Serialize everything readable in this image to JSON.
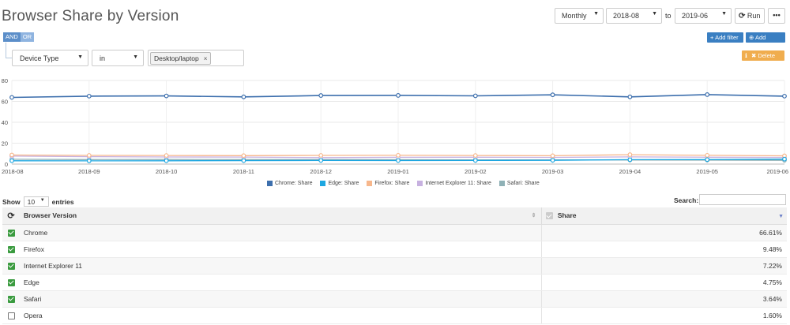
{
  "header": {
    "title": "Browser Share by Version",
    "interval": "Monthly",
    "date_from": "2018-08",
    "to_label": "to",
    "date_to": "2019-06",
    "run_label": "Run",
    "more_label": "•••"
  },
  "filters": {
    "and_label": "AND",
    "or_label": "OR",
    "add_filter_label": "Add filter",
    "add_group_label": "Add group",
    "delete_label": "Delete",
    "field": "Device Type",
    "operator": "in",
    "value_tag": "Desktop/laptop"
  },
  "chart_data": {
    "type": "line",
    "x": [
      "2018-08",
      "2018-09",
      "2018-10",
      "2018-11",
      "2018-12",
      "2019-01",
      "2019-02",
      "2019-03",
      "2019-04",
      "2019-05",
      "2019-06"
    ],
    "ylim": [
      0,
      80
    ],
    "yticks": [
      0,
      20,
      40,
      60,
      80
    ],
    "grid": true,
    "legend_position": "bottom",
    "series": [
      {
        "name": "Chrome: Share",
        "color": "#3d6fad",
        "values": [
          63.8,
          65.0,
          65.2,
          64.3,
          65.6,
          65.7,
          65.3,
          66.3,
          64.3,
          66.5,
          65.0
        ]
      },
      {
        "name": "Edge: Share",
        "color": "#1ea7e1",
        "values": [
          3.2,
          3.1,
          3.2,
          3.3,
          3.5,
          3.4,
          3.5,
          3.6,
          4.2,
          4.3,
          4.75
        ]
      },
      {
        "name": "Firefox: Share",
        "color": "#f7b78c",
        "values": [
          8.7,
          8.3,
          8.2,
          8.1,
          8.3,
          8.4,
          8.2,
          8.0,
          9.0,
          8.4,
          7.9
        ]
      },
      {
        "name": "Internet Explorer 11: Share",
        "color": "#c7b1e0",
        "values": [
          7.6,
          7.1,
          6.8,
          6.7,
          6.2,
          6.5,
          6.6,
          6.4,
          6.9,
          6.6,
          6.4
        ]
      },
      {
        "name": "Safari: Share",
        "color": "#8fb1b6",
        "values": [
          4.6,
          4.3,
          4.4,
          4.3,
          4.3,
          4.2,
          4.1,
          4.0,
          3.9,
          3.8,
          3.64
        ]
      }
    ]
  },
  "table": {
    "show_label": "Show",
    "entries_value": "10",
    "entries_label": "entries",
    "search_label": "Search:",
    "col_version": "Browser Version",
    "col_share": "Share",
    "rows": [
      {
        "name": "Chrome",
        "share": "66.61%",
        "checked": true
      },
      {
        "name": "Firefox",
        "share": "9.48%",
        "checked": true
      },
      {
        "name": "Internet Explorer 11",
        "share": "7.22%",
        "checked": true
      },
      {
        "name": "Edge",
        "share": "4.75%",
        "checked": true
      },
      {
        "name": "Safari",
        "share": "3.64%",
        "checked": true
      },
      {
        "name": "Opera",
        "share": "1.60%",
        "checked": false
      }
    ]
  }
}
